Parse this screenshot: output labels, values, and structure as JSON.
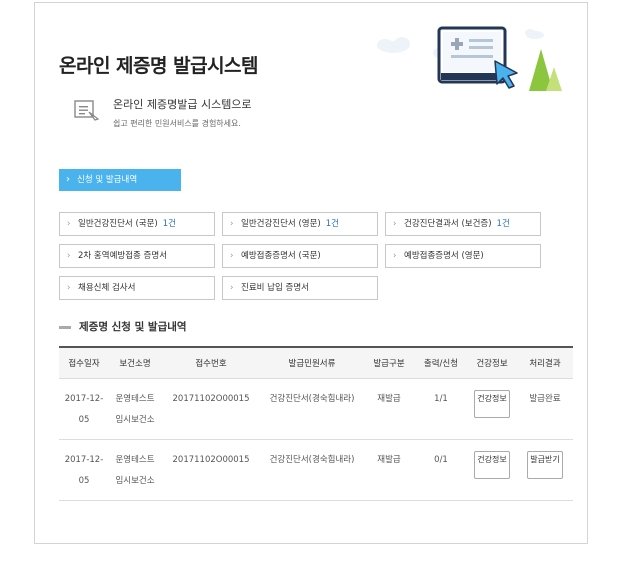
{
  "page": {
    "title": "온라인 제증명 발급시스템",
    "intro_title": "온라인 제증명발급 시스템으로",
    "intro_sub": "쉽고 편리한 민원서비스를 경험하세요."
  },
  "primary_button": "신청 및 발급내역",
  "certificates": [
    {
      "label": "일반건강진단서 (국문)",
      "count": "1건"
    },
    {
      "label": "일반건강진단서 (영문)",
      "count": "1건"
    },
    {
      "label": "건강진단결과서 (보건증)",
      "count": "1건"
    },
    {
      "label": "2차 홍역예방접종 증명서",
      "count": ""
    },
    {
      "label": "예방접종증명서 (국문)",
      "count": ""
    },
    {
      "label": "예방접종증명서 (영문)",
      "count": ""
    },
    {
      "label": "채용신체 검사서",
      "count": ""
    },
    {
      "label": "진료비 납입 증명서",
      "count": ""
    }
  ],
  "history": {
    "title": "제증명 신청 및 발급내역",
    "headers": [
      "접수일자",
      "보건소명",
      "접수번호",
      "발급민원서류",
      "발급구분",
      "출력/신청",
      "건강정보",
      "처리결과"
    ],
    "rows": [
      {
        "date": "2017-12-05",
        "center": "운영테스트 임시보건소",
        "number": "20171102O00015",
        "doc": "건강진단서(경숙힘내라)",
        "type": "재발급",
        "print": "1/1",
        "health_btn": "건강정보",
        "result": "발급완료",
        "result_is_button": false
      },
      {
        "date": "2017-12-05",
        "center": "운영테스트 임시보건소",
        "number": "20171102O00015",
        "doc": "건강진단서(경숙힘내라)",
        "type": "재발급",
        "print": "0/1",
        "health_btn": "건강정보",
        "result": "발급받기",
        "result_is_button": true
      }
    ]
  },
  "colors": {
    "accent": "#4ab3ee",
    "count_blue": "#2a6fc9",
    "tree_green": "#8cc63f",
    "tree_light": "#c3e07a",
    "monitor_navy": "#233656"
  },
  "icons": {
    "intro": "document-pen-icon",
    "hero": "monitor-cursor-icon",
    "chevron": "chevron-right-icon"
  }
}
